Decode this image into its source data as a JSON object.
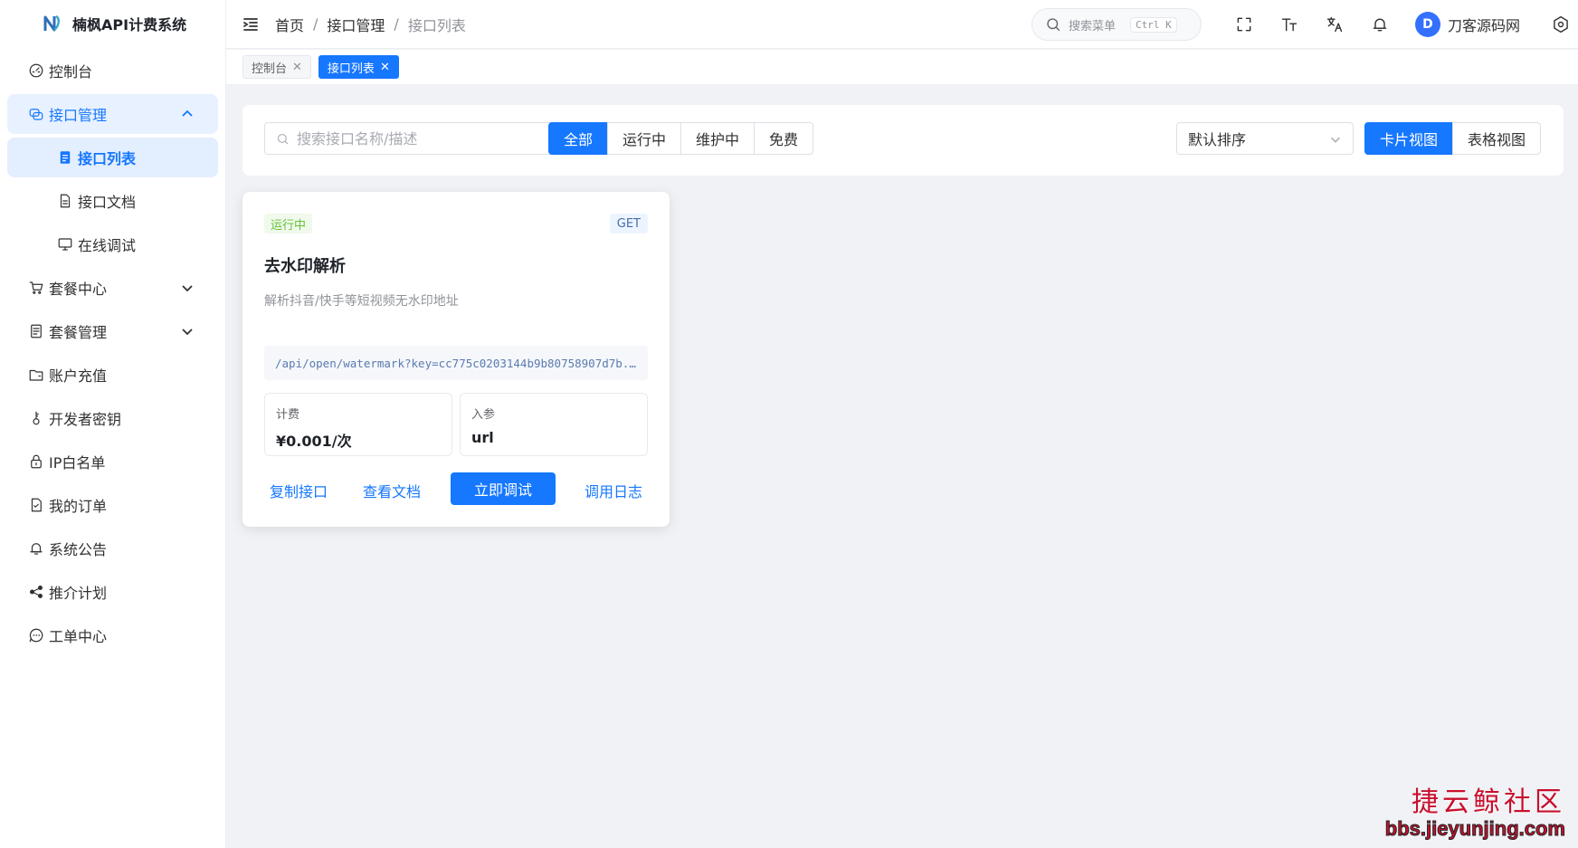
{
  "app": {
    "title": "楠枫API计费系统"
  },
  "sidebar": {
    "items": [
      {
        "label": "控制台",
        "icon": "dashboard-icon"
      },
      {
        "label": "接口管理",
        "icon": "api-icon",
        "expanded": true,
        "children": [
          {
            "label": "接口列表",
            "icon": "list-icon",
            "active": true
          },
          {
            "label": "接口文档",
            "icon": "document-icon"
          },
          {
            "label": "在线调试",
            "icon": "monitor-icon"
          }
        ]
      },
      {
        "label": "套餐中心",
        "icon": "cart-icon",
        "collapsible": true
      },
      {
        "label": "套餐管理",
        "icon": "doc-list-icon",
        "collapsible": true
      },
      {
        "label": "账户充值",
        "icon": "wallet-icon"
      },
      {
        "label": "开发者密钥",
        "icon": "key-icon"
      },
      {
        "label": "IP白名单",
        "icon": "lock-icon"
      },
      {
        "label": "我的订单",
        "icon": "order-icon"
      },
      {
        "label": "系统公告",
        "icon": "bell-icon"
      },
      {
        "label": "推介计划",
        "icon": "share-icon"
      },
      {
        "label": "工单中心",
        "icon": "chat-icon"
      }
    ]
  },
  "header": {
    "breadcrumb": [
      "首页",
      "接口管理",
      "接口列表"
    ],
    "search_placeholder": "搜索菜单",
    "search_shortcut": "Ctrl K",
    "user": {
      "avatar_letter": "D",
      "name": "刀客源码网"
    },
    "icons": [
      "fullscreen-icon",
      "font-size-icon",
      "translate-icon",
      "notification-bell-icon",
      "settings-icon"
    ]
  },
  "tabs": [
    {
      "label": "控制台",
      "active": false
    },
    {
      "label": "接口列表",
      "active": true
    }
  ],
  "filter": {
    "search_placeholder": "搜索接口名称/描述",
    "status_options": [
      "全部",
      "运行中",
      "维护中",
      "免费"
    ],
    "status_selected": "全部",
    "sort_value": "默认排序",
    "view_options": [
      "卡片视图",
      "表格视图"
    ],
    "view_selected": "卡片视图"
  },
  "api_cards": [
    {
      "status": "运行中",
      "method": "GET",
      "name": "去水印解析",
      "description": "解析抖音/快手等短视频无水印地址",
      "endpoint": "/api/open/watermark?key=cc775c0203144b9b80758907d7b...",
      "price_label": "计费",
      "price_value": "¥0.001/次",
      "params_label": "入参",
      "params_value": "url",
      "actions": {
        "copy": "复制接口",
        "docs": "查看文档",
        "debug": "立即调试",
        "logs": "调用日志"
      }
    }
  ],
  "watermark": {
    "line1": "捷云鲸社区",
    "line2": "bbs.jieyunjing.com"
  },
  "colors": {
    "primary": "#1677ff",
    "success": "#67c23a",
    "background": "#f1f2f5"
  }
}
